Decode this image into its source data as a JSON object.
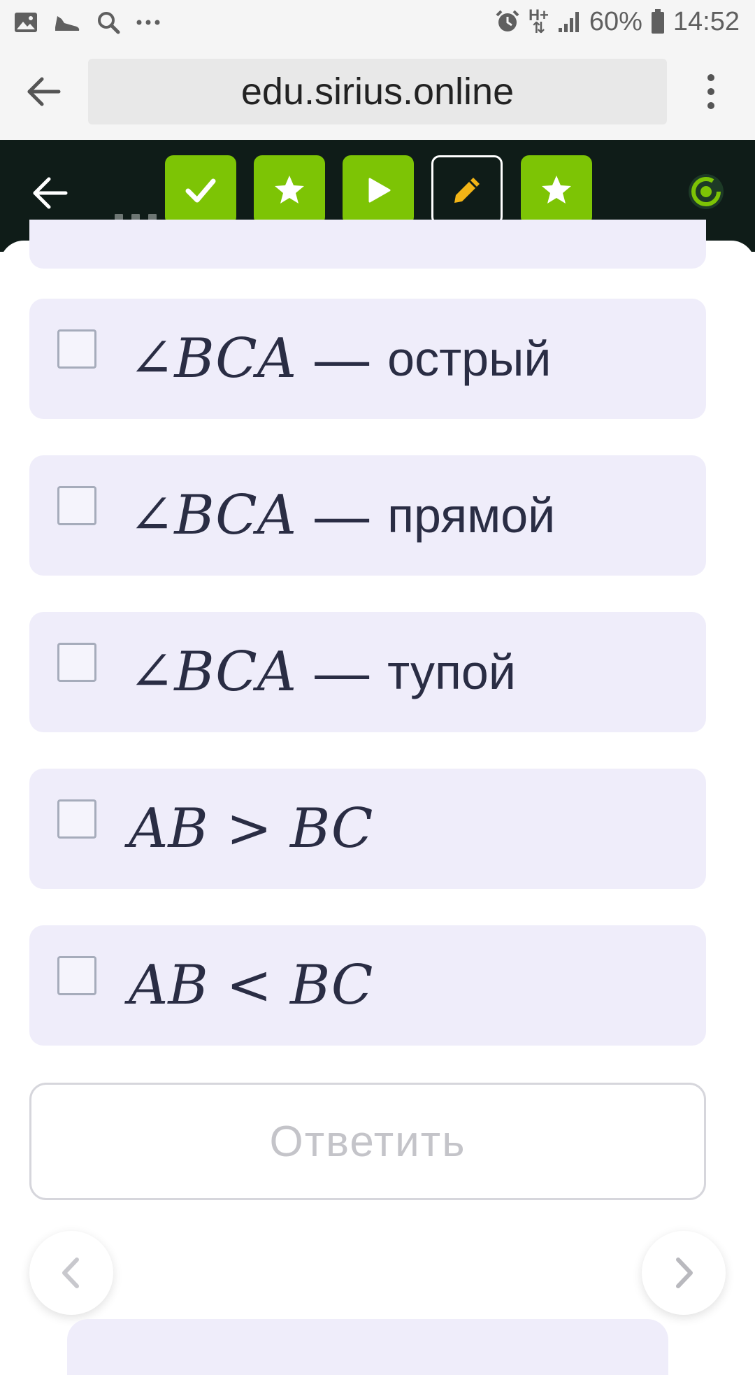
{
  "status_bar": {
    "battery_percent": "60%",
    "time": "14:52",
    "network": "H+",
    "icons": [
      "image-icon",
      "shoe-icon",
      "search-icon",
      "more-icon",
      "alarm-icon",
      "network-icon",
      "signal-icon",
      "battery-icon"
    ]
  },
  "browser": {
    "url": "edu.sirius.online",
    "back_icon": "arrow-left-icon",
    "menu_icon": "vertical-dots-icon"
  },
  "toolbar": {
    "steps": [
      {
        "icon": "check-icon",
        "state": "done"
      },
      {
        "icon": "star-icon",
        "state": "done"
      },
      {
        "icon": "play-icon",
        "state": "done"
      },
      {
        "icon": "pencil-icon",
        "state": "current"
      },
      {
        "icon": "star-icon",
        "state": "done"
      }
    ],
    "accent_color": "#7dc405",
    "background_color": "#0f1c18",
    "pencil_color": "#f2b416"
  },
  "options": [
    {
      "math": "∠BCA",
      "sep": "—",
      "text": "острый",
      "checked": false
    },
    {
      "math": "∠BCA",
      "sep": "—",
      "text": "прямой",
      "checked": false
    },
    {
      "math": "∠BCA",
      "sep": "—",
      "text": "тупой",
      "checked": false
    },
    {
      "left": "AB",
      "rel": ">",
      "right": "BC",
      "checked": false
    },
    {
      "left": "AB",
      "rel": "<",
      "right": "BC",
      "checked": false
    }
  ],
  "answer_button": {
    "label": "Ответить",
    "enabled": false
  },
  "nav": {
    "prev_icon": "chevron-left-icon",
    "next_icon": "chevron-right-icon"
  },
  "colors": {
    "option_bg": "#efedfa",
    "text": "#2a2d44",
    "disabled_text": "#c4c4c9"
  }
}
